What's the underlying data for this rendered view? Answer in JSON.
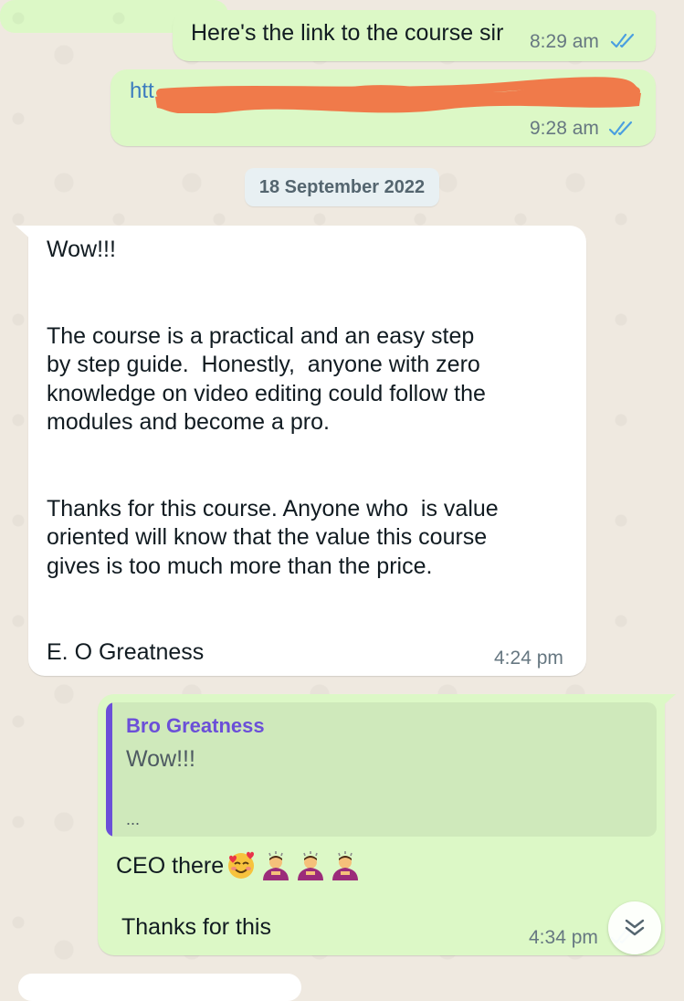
{
  "messages": {
    "m1": {
      "text": "Here's the link to the course sir",
      "time": "8:29 am",
      "status_icon": "double-check-read-icon"
    },
    "m2": {
      "link_prefix": "htt",
      "time": "9:28 am",
      "status_icon": "double-check-read-icon"
    },
    "date_separator": "18 September 2022",
    "m3": {
      "text": "Wow!!!\n\n\nThe course is a practical and an easy step\nby step guide.  Honestly,  anyone with zero\nknowledge on video editing could follow the\nmodules and become a pro.\n\n\nThanks for this course. Anyone who  is value\noriented will know that the value this course\ngives is too much more than the price.\n\n\nE. O Greatness",
      "time": "4:24 pm"
    },
    "m4": {
      "quote_author": "Bro Greatness",
      "quote_text": "Wow!!!",
      "quote_more": "...",
      "line1": "CEO there",
      "line2": "Thanks for this",
      "time": "4:34 pm"
    }
  },
  "colors": {
    "outgoing_bubble": "#dcf8c6",
    "incoming_bubble": "#ffffff",
    "read_ticks": "#4a9fe0",
    "quote_accent": "#6b4fd8",
    "redaction": "#f07a4a"
  },
  "icons": [
    "double-check-read-icon",
    "smiling-face-with-hearts-icon",
    "bowing-person-icon",
    "scroll-down-chevron-icon"
  ]
}
